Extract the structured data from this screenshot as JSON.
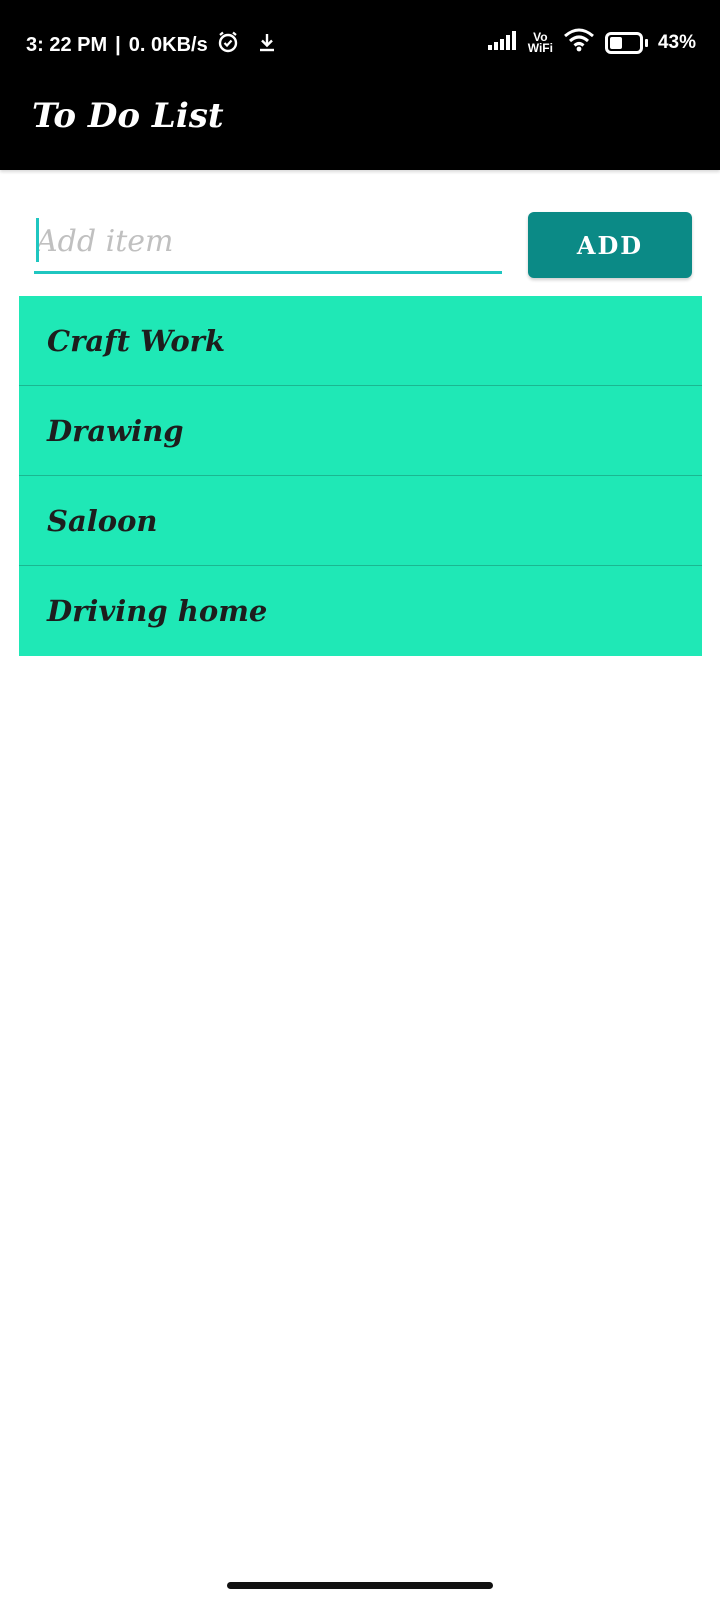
{
  "status_bar": {
    "time": "3: 22 PM",
    "separator": "|",
    "network_speed": "0. 0KB/s",
    "alarm_icon": "alarm-icon",
    "download_icon": "download-icon",
    "signal_icon": "signal-icon",
    "vowifi_top": "Vo",
    "vowifi_bottom": "WiFi",
    "wifi_icon": "wifi-icon",
    "battery_level": 0.43,
    "battery_text": "43%"
  },
  "app_bar": {
    "title": "To Do List",
    "background": "#000000"
  },
  "input": {
    "value": "",
    "placeholder": "Add item",
    "accent": "#1fc6c0"
  },
  "add_button": {
    "label": "ADD",
    "color": "#0b8a86"
  },
  "list": {
    "background": "#1fe8b6",
    "items": [
      {
        "label": "Craft Work"
      },
      {
        "label": "Drawing"
      },
      {
        "label": "Saloon"
      },
      {
        "label": "Driving home"
      }
    ]
  }
}
